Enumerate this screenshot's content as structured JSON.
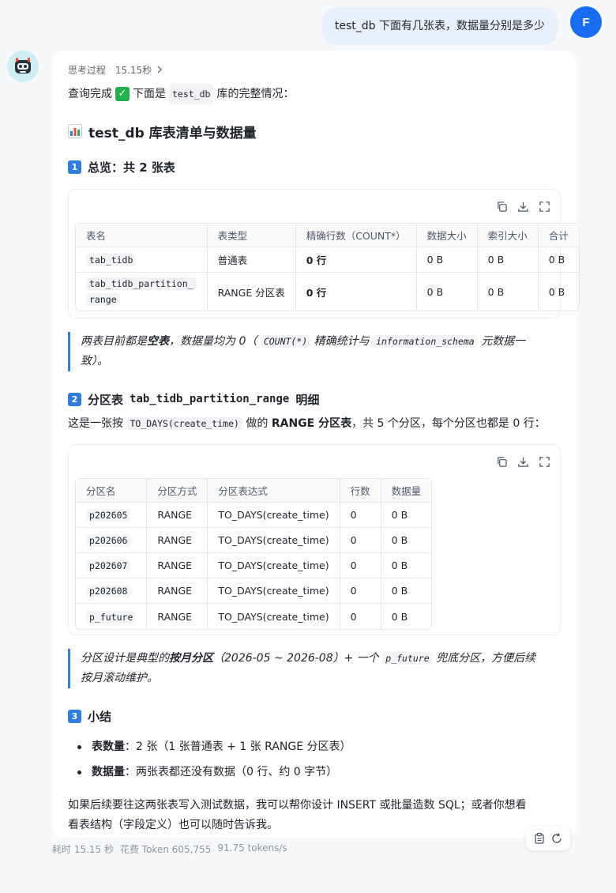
{
  "user": {
    "message": "test_db 下面有几张表，数据量分别是多少",
    "avatar_letter": "F"
  },
  "assistant": {
    "thinking_label": "思考过程",
    "thinking_time": "15.15秒",
    "intro_prefix": "查询完成",
    "intro_middle": "下面是",
    "intro_code": "test_db",
    "intro_suffix": "库的完整情况：",
    "title": "test_db 库表清单与数据量",
    "section1": {
      "number": "1",
      "title": "总览：共 2 张表",
      "headers": [
        "表名",
        "表类型",
        "精确行数（COUNT*）",
        "数据大小",
        "索引大小",
        "合计"
      ],
      "rows": [
        {
          "name": "tab_tidb",
          "type": "普通表",
          "count": "0 行",
          "data": "0 B",
          "index": "0 B",
          "total": "0 B"
        },
        {
          "name_line1": "tab_tidb_partition_",
          "name_line2": "range",
          "type": "RANGE 分区表",
          "count": "0 行",
          "data": "0 B",
          "index": "0 B",
          "total": "0 B"
        }
      ],
      "quote_a": "两表目前都是",
      "quote_b": "空表",
      "quote_c": "，数据量均为 0（",
      "quote_code1": "COUNT(*)",
      "quote_d": "精确统计与",
      "quote_code2": "information_schema",
      "quote_e": "元数据一",
      "quote_f": "致）。"
    },
    "section2": {
      "number": "2",
      "title_prefix": "分区表",
      "title_code": "tab_tidb_partition_range",
      "title_suffix": "明细",
      "desc_a": "这是一张按",
      "desc_code": "TO_DAYS(create_time)",
      "desc_b": "做的",
      "desc_bold": "RANGE 分区表",
      "desc_c": "，共 5 个分区，每个分区也都是 0 行：",
      "headers": [
        "分区名",
        "分区方式",
        "分区表达式",
        "行数",
        "数据量"
      ],
      "rows": [
        {
          "name": "p202605",
          "method": "RANGE",
          "expr": "TO_DAYS(create_time)",
          "rows": "0",
          "size": "0 B"
        },
        {
          "name": "p202606",
          "method": "RANGE",
          "expr": "TO_DAYS(create_time)",
          "rows": "0",
          "size": "0 B"
        },
        {
          "name": "p202607",
          "method": "RANGE",
          "expr": "TO_DAYS(create_time)",
          "rows": "0",
          "size": "0 B"
        },
        {
          "name": "p202608",
          "method": "RANGE",
          "expr": "TO_DAYS(create_time)",
          "rows": "0",
          "size": "0 B"
        },
        {
          "name": "p_future",
          "method": "RANGE",
          "expr": "TO_DAYS(create_time)",
          "rows": "0",
          "size": "0 B"
        }
      ],
      "quote_a": "分区设计是典型的",
      "quote_b": "按月分区",
      "quote_c": "（2026-05 ~ 2026-08）+ 一个",
      "quote_code": "p_future",
      "quote_d": "兜底分区，方便后续",
      "quote_e": "按月滚动维护。"
    },
    "section3": {
      "number": "3",
      "title": "小结",
      "item1_label": "表数量",
      "item1_text": "：2 张（1 张普通表 + 1 张 RANGE 分区表）",
      "item2_label": "数据量",
      "item2_text": "：两张表都还没有数据（0 行、约 0 字节）"
    },
    "closing_line1": "如果后续要往这两张表写入测试数据，我可以帮你设计 INSERT 或批量造数 SQL；或者你想看",
    "closing_line2": "看表结构（字段定义）也可以随时告诉我。"
  },
  "footer": {
    "time": "耗时 15.15 秒",
    "tokens": "花费 Token 605,755",
    "speed": "91.75 tokens/s"
  },
  "colors": {
    "accent": "#2f7de1",
    "user_avatar": "#1a6cf0",
    "user_bubble": "#e8f0fe",
    "check": "#22b14c"
  }
}
